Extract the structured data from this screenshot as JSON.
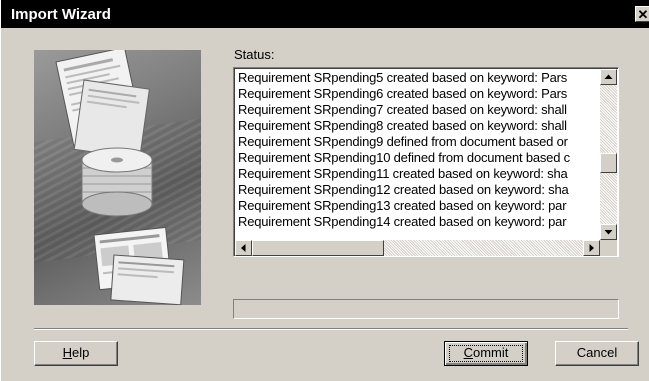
{
  "window": {
    "title": "Import Wizard",
    "close_glyph": "✕"
  },
  "status": {
    "label": "Status:",
    "lines": [
      "Requirement SRpending5 created based on keyword: Pars",
      "Requirement SRpending6 created based on keyword: Pars",
      "Requirement SRpending7 created based on keyword: shall",
      "Requirement SRpending8 created based on keyword: shall",
      "Requirement SRpending9 defined from document based or",
      "Requirement SRpending10 defined from document based c",
      "Requirement SRpending11 created based on keyword: sha",
      "Requirement SRpending12 created based on keyword: sha",
      "Requirement SRpending13 created based on keyword: par",
      "Requirement SRpending14 created based on keyword: par"
    ]
  },
  "scrollbar": {
    "up_icon": "triangle-up-icon",
    "down_icon": "triangle-down-icon",
    "left_icon": "triangle-left-icon",
    "right_icon": "triangle-right-icon"
  },
  "progress": {
    "fraction": 0
  },
  "buttons": {
    "help": {
      "mnemonic": "H",
      "rest": "elp"
    },
    "commit": {
      "mnemonic": "C",
      "rest": "ommit"
    },
    "cancel": {
      "label": "Cancel"
    }
  },
  "colors": {
    "titlebar": "#000000",
    "face": "#d4d0c8",
    "listbox": "#ffffff"
  }
}
